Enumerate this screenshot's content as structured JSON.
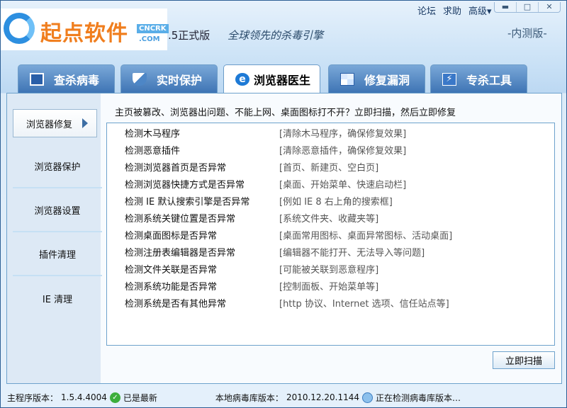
{
  "header": {
    "logo_text": "起点软件",
    "logo_badge": "CNCRK",
    "logo_domain": ".COM",
    "version": ".5正式版",
    "slogan": "全球领先的杀毒引擎",
    "edition": "-内测版-",
    "links": [
      "论坛",
      "求助",
      "高级▾"
    ],
    "window_buttons": [
      "▬",
      "□",
      "✕"
    ]
  },
  "tabs": [
    {
      "label": "查杀病毒",
      "icon": "monitor-icon"
    },
    {
      "label": "实时保护",
      "icon": "shield-icon"
    },
    {
      "label": "浏览器医生",
      "icon": "ie-icon",
      "active": true
    },
    {
      "label": "修复漏洞",
      "icon": "windows-icon"
    },
    {
      "label": "专杀工具",
      "icon": "lightning-icon"
    }
  ],
  "sidebar": {
    "items": [
      "浏览器修复",
      "浏览器保护",
      "浏览器设置",
      "插件清理",
      "IE 清理"
    ],
    "active": 0
  },
  "main": {
    "intro": "主页被篡改、浏览器出问题、不能上网、桌面图标打不开？立即扫描，然后立即修复",
    "checks": [
      {
        "name": "检测木马程序",
        "desc": "[清除木马程序，确保修复效果]"
      },
      {
        "name": "检测恶意插件",
        "desc": "[清除恶意插件，确保修复效果]"
      },
      {
        "name": "检测浏览器首页是否异常",
        "desc": "[首页、新建页、空白页]"
      },
      {
        "name": "检测浏览器快捷方式是否异常",
        "desc": "[桌面、开始菜单、快速启动栏]"
      },
      {
        "name": "检测 IE 默认搜索引擎是否异常",
        "desc": "[例如 IE 8 右上角的搜索框]"
      },
      {
        "name": "检测系统关键位置是否异常",
        "desc": "[系统文件夹、收藏夹等]"
      },
      {
        "name": "检测桌面图标是否异常",
        "desc": "[桌面常用图标、桌面异常图标、活动桌面]"
      },
      {
        "name": "检测注册表编辑器是否异常",
        "desc": "[编辑器不能打开、无法导入等问题]"
      },
      {
        "name": "检测文件关联是否异常",
        "desc": "[可能被关联到恶意程序]"
      },
      {
        "name": "检测系统功能是否异常",
        "desc": "[控制面板、开始菜单等]"
      },
      {
        "name": "检测系统是否有其他异常",
        "desc": "[http 协议、Internet 选项、信任站点等]"
      }
    ],
    "scan_button": "立即扫描"
  },
  "status": {
    "program_label": "主程序版本：",
    "program_version": "1.5.4.4004",
    "program_state": "已是最新",
    "db_label": "本地病毒库版本：",
    "db_version": "2010.12.20.1144",
    "db_state": "正在检测病毒库版本…"
  }
}
